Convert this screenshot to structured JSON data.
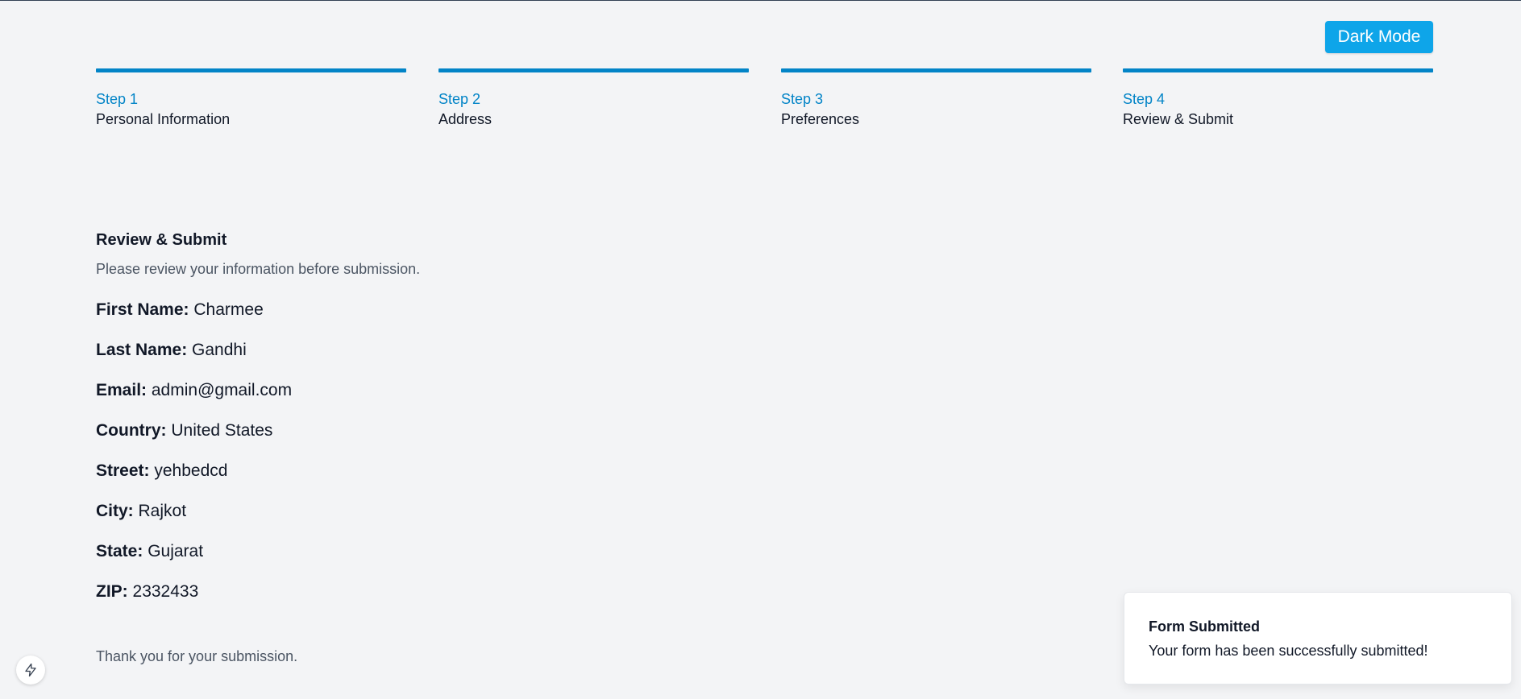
{
  "header": {
    "dark_mode_label": "Dark Mode"
  },
  "steps": [
    {
      "number": "Step 1",
      "name": "Personal Information"
    },
    {
      "number": "Step 2",
      "name": "Address"
    },
    {
      "number": "Step 3",
      "name": "Preferences"
    },
    {
      "number": "Step 4",
      "name": "Review & Submit"
    }
  ],
  "review": {
    "title": "Review & Submit",
    "description": "Please review your information before submission.",
    "fields": [
      {
        "label": "First Name:",
        "value": "Charmee"
      },
      {
        "label": "Last Name:",
        "value": "Gandhi"
      },
      {
        "label": "Email:",
        "value": "admin@gmail.com"
      },
      {
        "label": "Country:",
        "value": "United States"
      },
      {
        "label": "Street:",
        "value": "yehbedcd"
      },
      {
        "label": "City:",
        "value": "Rajkot"
      },
      {
        "label": "State:",
        "value": "Gujarat"
      },
      {
        "label": "ZIP:",
        "value": "2332433"
      }
    ],
    "thanks": "Thank you for your submission."
  },
  "toast": {
    "title": "Form Submitted",
    "message": "Your form has been successfully submitted!"
  },
  "icons": {
    "floating_button": "lightning-bolt-icon"
  },
  "colors": {
    "background": "#f3f4f6",
    "accent": "#0284c7",
    "button": "#0ea5e9",
    "text": "#111827",
    "muted_text": "#4b5563"
  }
}
